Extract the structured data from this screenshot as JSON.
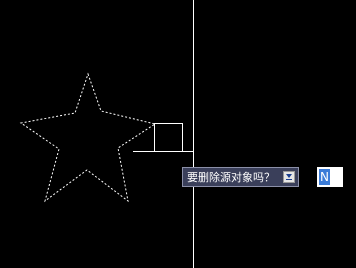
{
  "dynamic_input": {
    "prompt": "要删除源对象吗？",
    "options_icon": "down-arrow-icon",
    "value": "N"
  },
  "colors": {
    "background": "#000000",
    "crosshair": "#ffffff",
    "selected_object": "#ffffff",
    "prompt_background": "#3a3f5a",
    "input_highlight": "#3b7cd8"
  }
}
